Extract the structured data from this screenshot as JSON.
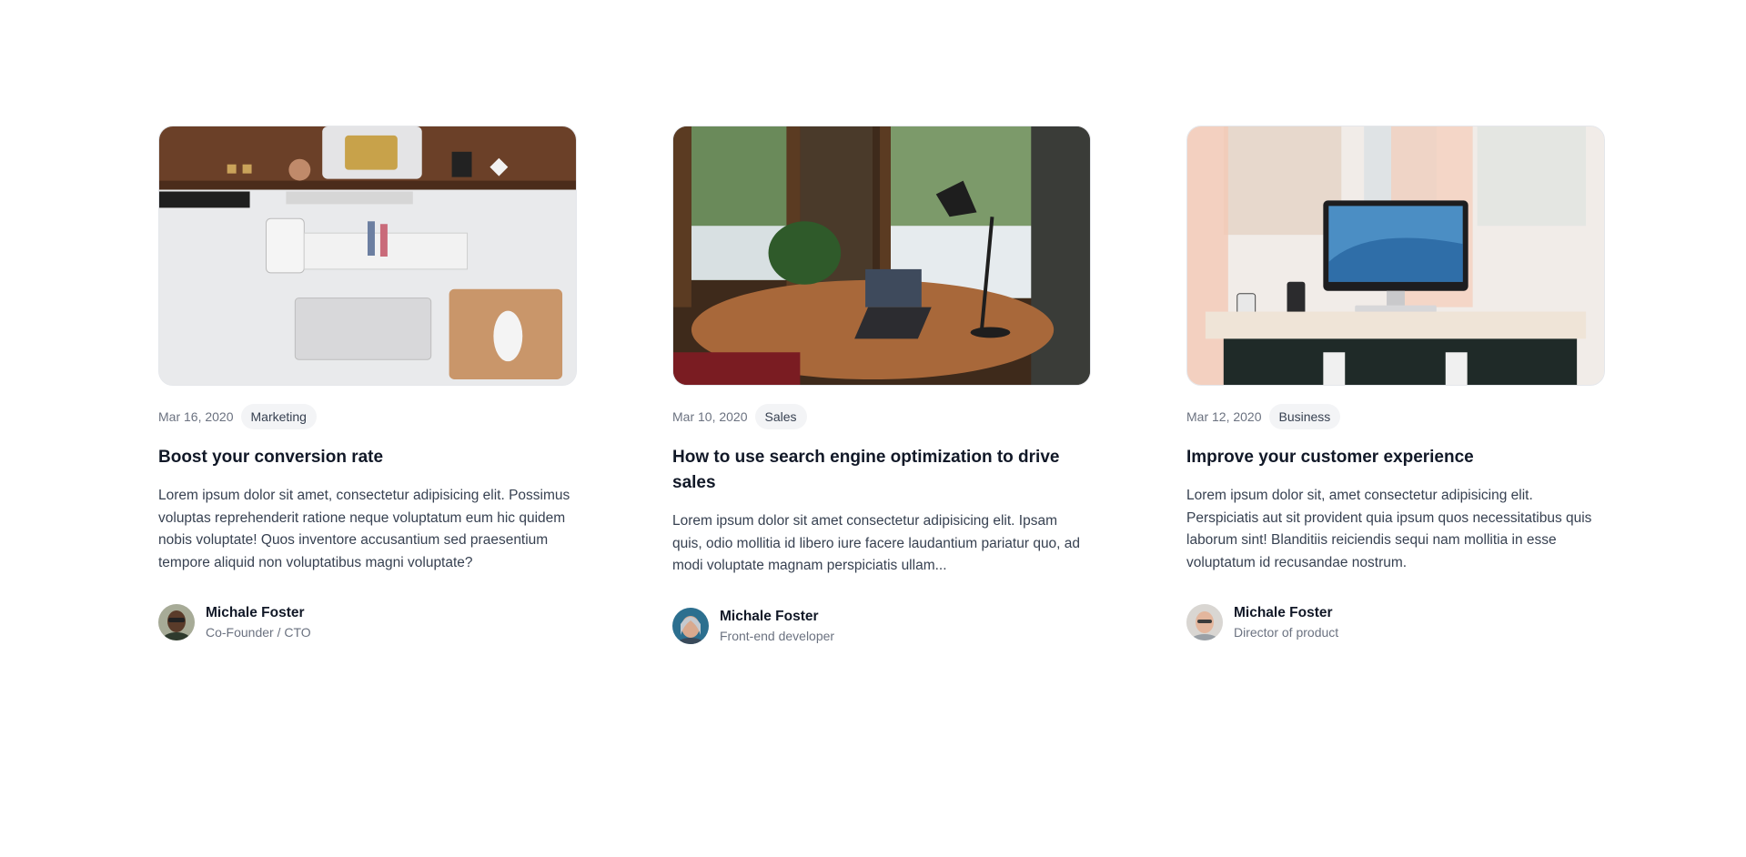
{
  "posts": [
    {
      "image": "desk-top-view-photo",
      "date": "Mar 16, 2020",
      "category": "Marketing",
      "title": "Boost your conversion rate",
      "excerpt": "Lorem ipsum dolor sit amet, consectetur adipisicing elit. Possimus voluptas reprehenderit ratione neque voluptatum eum hic quidem nobis voluptate! Quos inventore accusantium sed praesentium tempore aliquid non voluptatibus magni voluptate?",
      "author": {
        "name": "Michale Foster",
        "role": "Co-Founder / CTO",
        "avatar": "author-avatar-photo"
      }
    },
    {
      "image": "laptop-by-window-photo",
      "date": "Mar 10, 2020",
      "category": "Sales",
      "title": "How to use search engine optimization to drive sales",
      "excerpt": "Lorem ipsum dolor sit amet consectetur adipisicing elit. Ipsam quis, odio mollitia id libero iure facere laudantium pariatur quo, ad modi voluptate magnam perspiciatis ullam...",
      "author": {
        "name": "Michale Foster",
        "role": "Front-end developer",
        "avatar": "author-avatar-photo"
      }
    },
    {
      "image": "imac-workspace-photo",
      "date": "Mar 12, 2020",
      "category": "Business",
      "title": "Improve your customer experience",
      "excerpt": "Lorem ipsum dolor sit, amet consectetur adipisicing elit. Perspiciatis aut sit provident quia ipsum quos necessitatibus quis laborum sint! Blanditiis reiciendis sequi nam mollitia in esse voluptatum id recusandae nostrum.",
      "author": {
        "name": "Michale Foster",
        "role": "Director of product",
        "avatar": "author-avatar-photo"
      }
    }
  ],
  "colors": {
    "title": "#111827",
    "body": "#374151",
    "muted": "#6b7280",
    "badge_bg": "#f3f4f6"
  }
}
